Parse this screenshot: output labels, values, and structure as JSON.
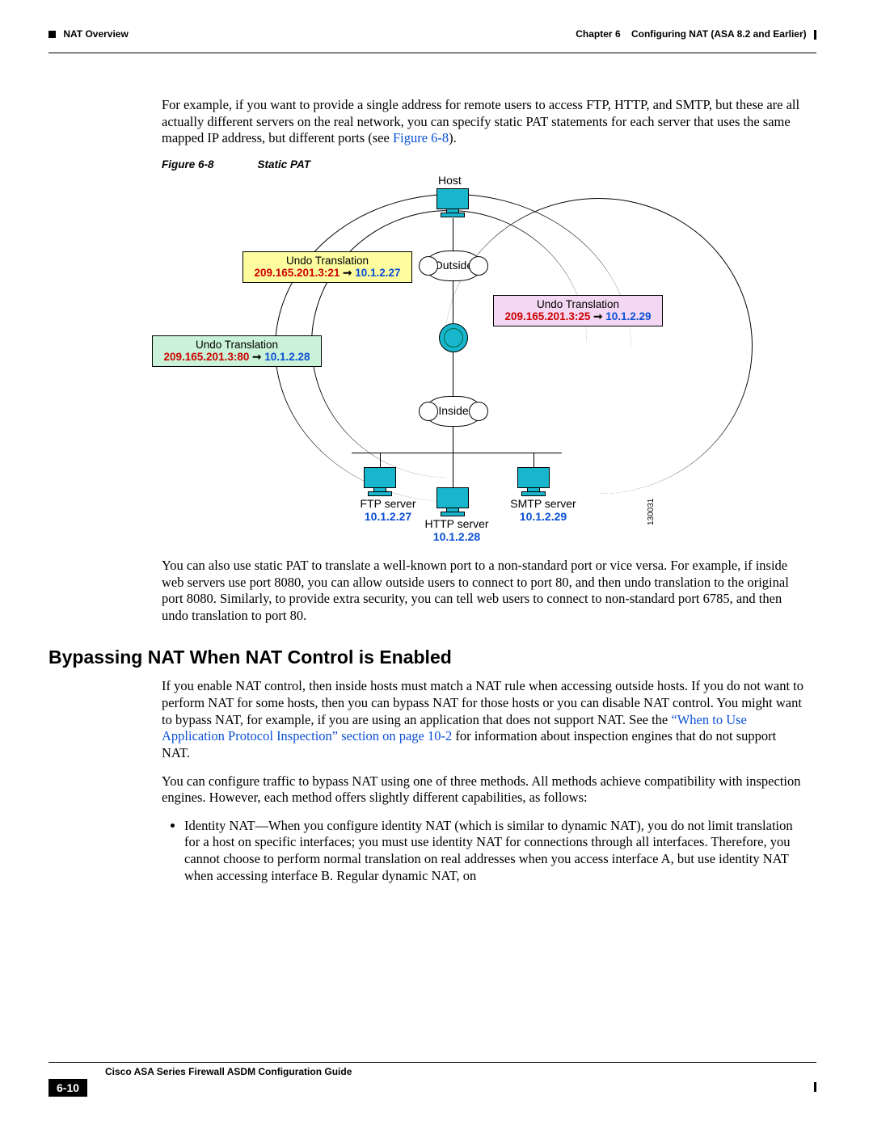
{
  "header": {
    "chapter": "Chapter 6",
    "chapter_title": "Configuring NAT (ASA 8.2 and Earlier)",
    "section": "NAT Overview"
  },
  "para1": "For example, if you want to provide a single address for remote users to access FTP, HTTP, and SMTP, but these are all actually different servers on the real network, you can specify static PAT statements for each server that uses the same mapped IP address, but different ports (see ",
  "para1_link": "Figure 6-8",
  "para1_tail": ").",
  "figure_caption_num": "Figure 6-8",
  "figure_caption_title": "Static PAT",
  "diagram": {
    "host_label": "Host",
    "outside_label": "Outside",
    "inside_label": "Inside",
    "ftp_label": "FTP server",
    "ftp_ip": "10.1.2.27",
    "http_label": "HTTP server",
    "http_ip": "10.1.2.28",
    "smtp_label": "SMTP server",
    "smtp_ip": "10.1.2.29",
    "image_id": "130031",
    "box1": {
      "title": "Undo Translation",
      "src": "209.165.201.3:21",
      "dst": "10.1.2.27"
    },
    "box2": {
      "title": "Undo Translation",
      "src": "209.165.201.3:80",
      "dst": "10.1.2.28"
    },
    "box3": {
      "title": "Undo Translation",
      "src": "209.165.201.3:25",
      "dst": "10.1.2.29"
    }
  },
  "para2": "You can also use static PAT to translate a well-known port to a non-standard port or vice versa. For example, if inside web servers use port 8080, you can allow outside users to connect to port 80, and then undo translation to the original port 8080. Similarly, to provide extra security, you can tell web users to connect to non-standard port 6785, and then undo translation to port 80.",
  "section_heading": "Bypassing NAT When NAT Control is Enabled",
  "para3a": "If you enable NAT control, then inside hosts must match a NAT rule when accessing outside hosts. If you do not want to perform NAT for some hosts, then you can bypass NAT for those hosts or you can disable NAT control. You might want to bypass NAT, for example, if you are using an application that does not support NAT. See the ",
  "para3_link": "“When to Use Application Protocol Inspection” section on page 10-2",
  "para3b": " for information about inspection engines that do not support NAT.",
  "para4": "You can configure traffic to bypass NAT using one of three methods. All methods achieve compatibility with inspection engines. However, each method offers slightly different capabilities, as follows:",
  "bullet1": "Identity NAT—When you configure identity NAT (which is similar to dynamic NAT), you do not limit translation for a host on specific interfaces; you must use identity NAT for connections through all interfaces. Therefore, you cannot choose to perform normal translation on real addresses when you access interface A, but use identity NAT when accessing interface B. Regular dynamic NAT, on",
  "footer": {
    "guide": "Cisco ASA Series Firewall ASDM Configuration Guide",
    "page": "6-10"
  }
}
